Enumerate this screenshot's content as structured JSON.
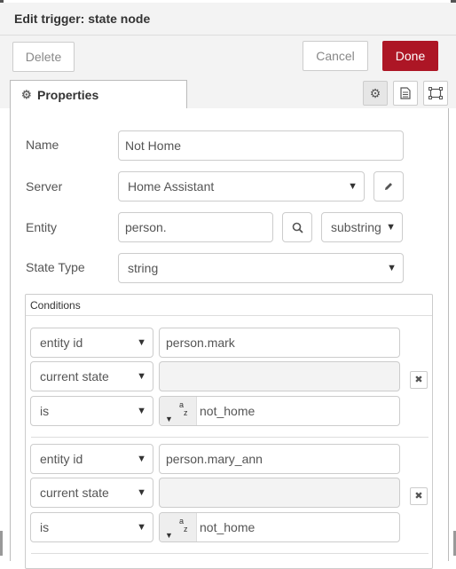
{
  "dialog": {
    "title": "Edit trigger: state node"
  },
  "toolbar": {
    "delete_label": "Delete",
    "cancel_label": "Cancel",
    "done_label": "Done",
    "done_color": "#ad1625"
  },
  "tabs": {
    "properties_label": "Properties"
  },
  "form": {
    "name_label": "Name",
    "name_value": "Not Home",
    "server_label": "Server",
    "server_value": "Home Assistant",
    "entity_label": "Entity",
    "entity_value": "person.",
    "entity_match": "substring",
    "state_type_label": "State Type",
    "state_type_value": "string"
  },
  "conditions": {
    "title": "Conditions",
    "items": [
      {
        "type": "entity id",
        "value": "person.mark",
        "compare_target": "current state",
        "compare_value": "",
        "operator": "is",
        "operand_value": "not_home"
      },
      {
        "type": "entity id",
        "value": "person.mary_ann",
        "compare_target": "current state",
        "compare_value": "",
        "operator": "is",
        "operand_value": "not_home"
      }
    ]
  },
  "icons": {
    "gear": "gear-icon",
    "description": "file-icon",
    "appearance": "frame-icon",
    "edit": "pencil-icon",
    "search": "search-icon",
    "remove": "close-icon"
  }
}
